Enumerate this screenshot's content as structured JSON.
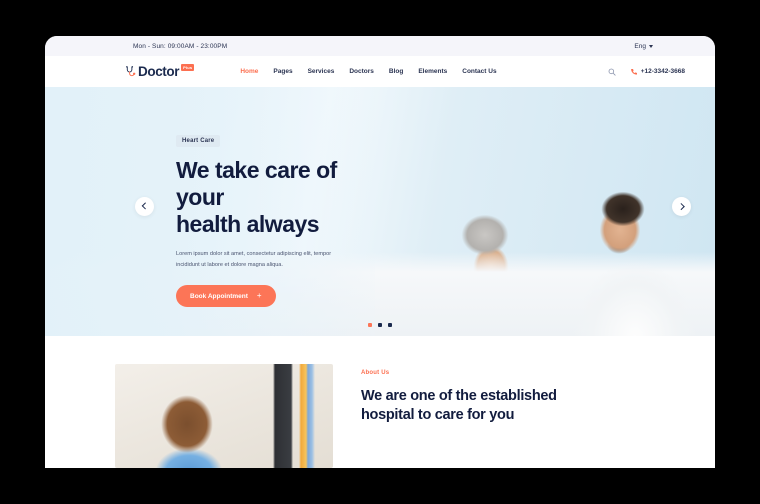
{
  "topbar": {
    "hours": "Mon - Sun: 09:00AM - 23:00PM",
    "language": "Eng"
  },
  "nav": {
    "logo_text": "Doctor",
    "logo_badge": "Plus",
    "items": [
      {
        "label": "Home",
        "active": true
      },
      {
        "label": "Pages",
        "active": false
      },
      {
        "label": "Services",
        "active": false
      },
      {
        "label": "Doctors",
        "active": false
      },
      {
        "label": "Blog",
        "active": false
      },
      {
        "label": "Elements",
        "active": false
      },
      {
        "label": "Contact Us",
        "active": false
      }
    ],
    "phone": "+12-3342-3668"
  },
  "hero": {
    "badge": "Heart Care",
    "title_line1": "We take care of your",
    "title_line2": "health always",
    "description": "Lorem ipsum dolor sit amet, consectetur adipiscing elit, tempor incididunt ut labore et dolore magna aliqua.",
    "cta_label": "Book Appointment",
    "cta_plus": "+",
    "dots": [
      {
        "active": true
      },
      {
        "active": false
      },
      {
        "active": false
      }
    ]
  },
  "about": {
    "eyebrow": "About Us",
    "title_line1": "We are one of the established",
    "title_line2": "hospital to care for you"
  },
  "colors": {
    "accent": "#fc6f50",
    "navy": "#121c3e",
    "topbar_bg": "#f5f5fa",
    "hero_bg": "#e3f1f8"
  }
}
